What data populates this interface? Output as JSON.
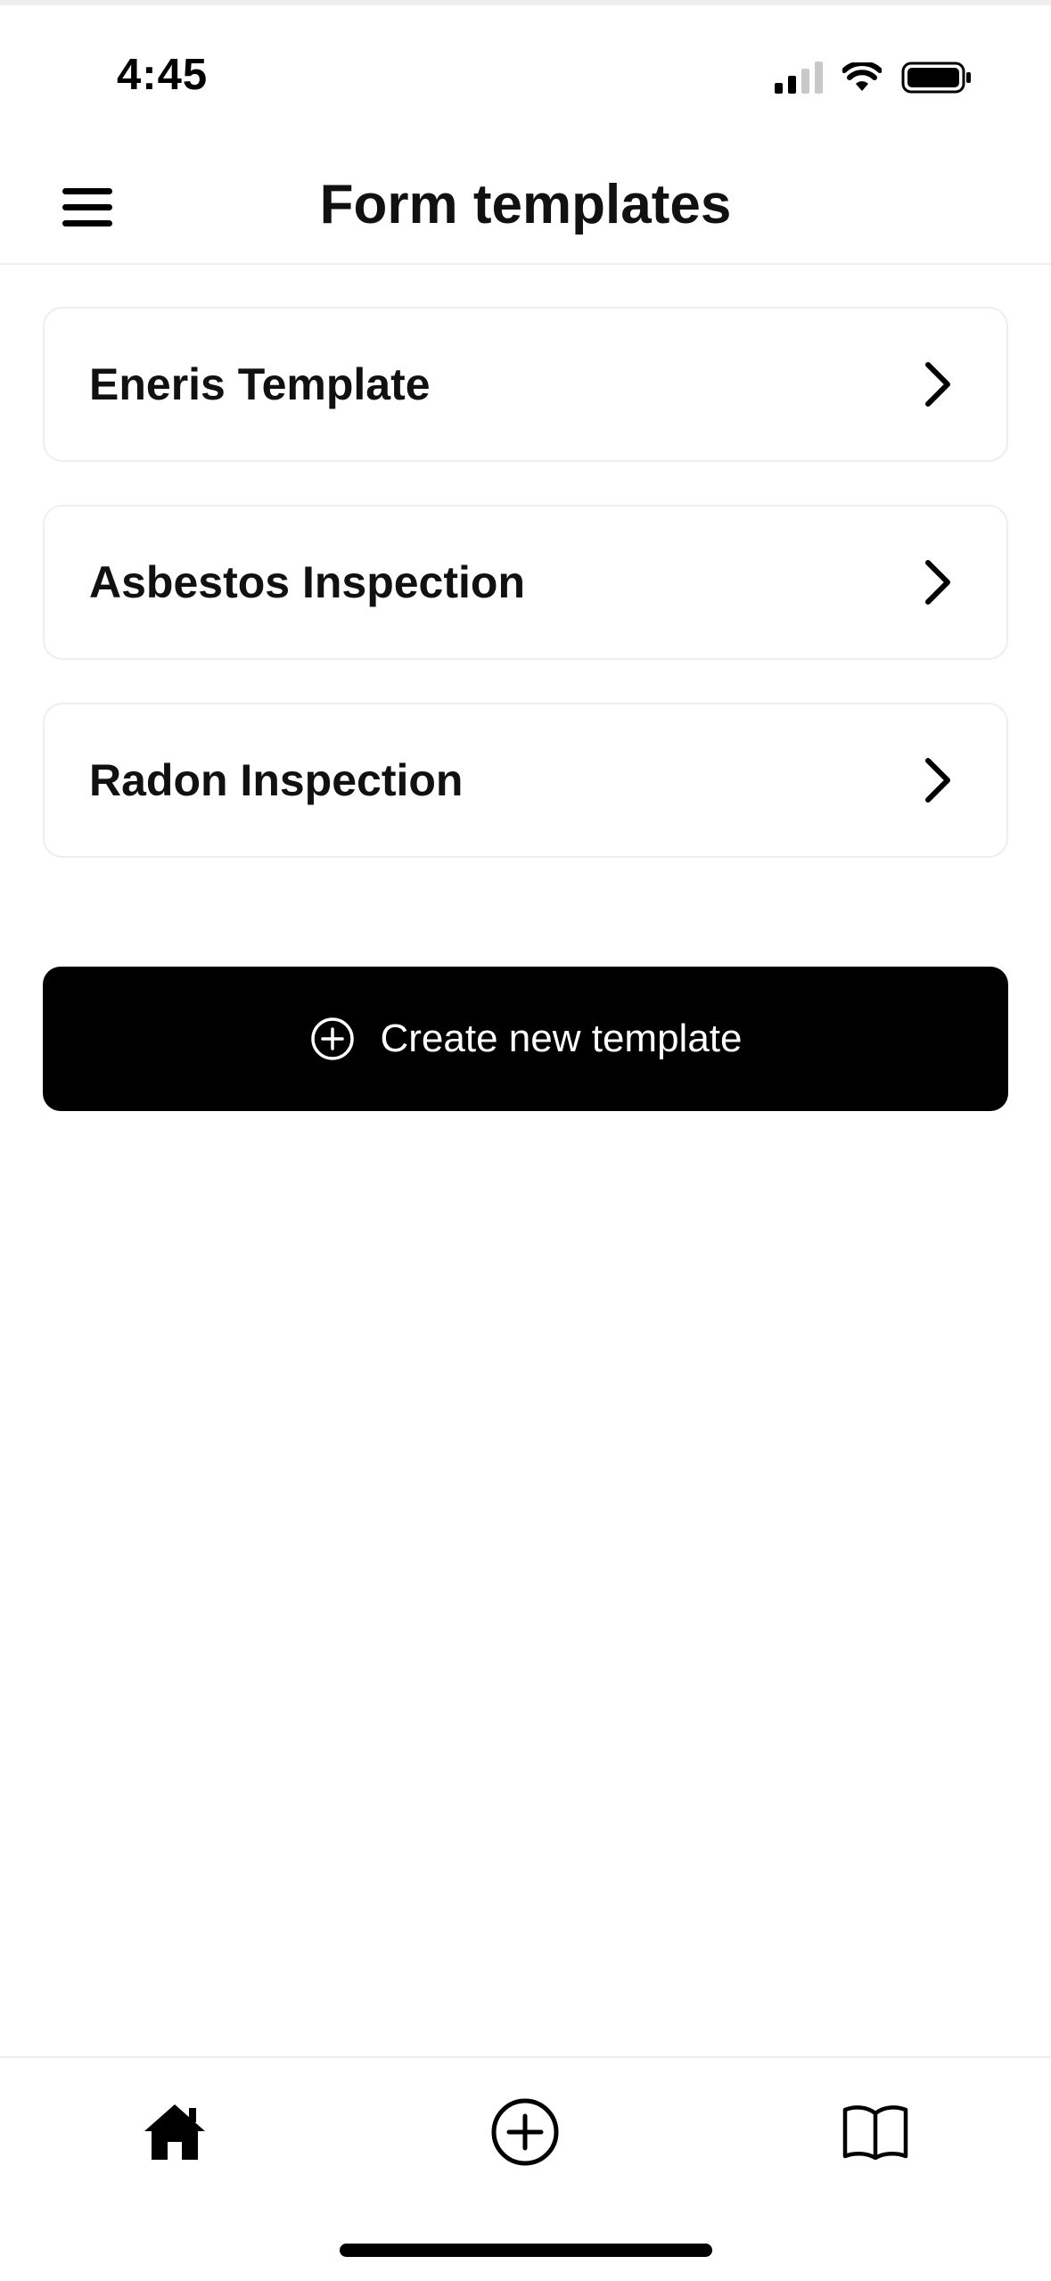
{
  "status_bar": {
    "time": "4:45",
    "icons": [
      "cellular-signal-icon",
      "wifi-icon",
      "battery-icon"
    ]
  },
  "header": {
    "title": "Form templates",
    "menu_icon": "hamburger-menu-icon"
  },
  "templates": [
    {
      "label": "Eneris Template"
    },
    {
      "label": "Asbestos Inspection"
    },
    {
      "label": "Radon Inspection"
    }
  ],
  "create_button": {
    "label": "Create new template",
    "icon": "plus-circle-icon"
  },
  "tab_bar": {
    "tabs": [
      {
        "icon": "home-icon",
        "active": true
      },
      {
        "icon": "plus-circle-icon",
        "active": false
      },
      {
        "icon": "book-icon",
        "active": false
      }
    ]
  },
  "colors": {
    "primary": "#000000",
    "background": "#ffffff",
    "card_border": "#eeeeee",
    "signal_dim": "#c9c9c9"
  }
}
